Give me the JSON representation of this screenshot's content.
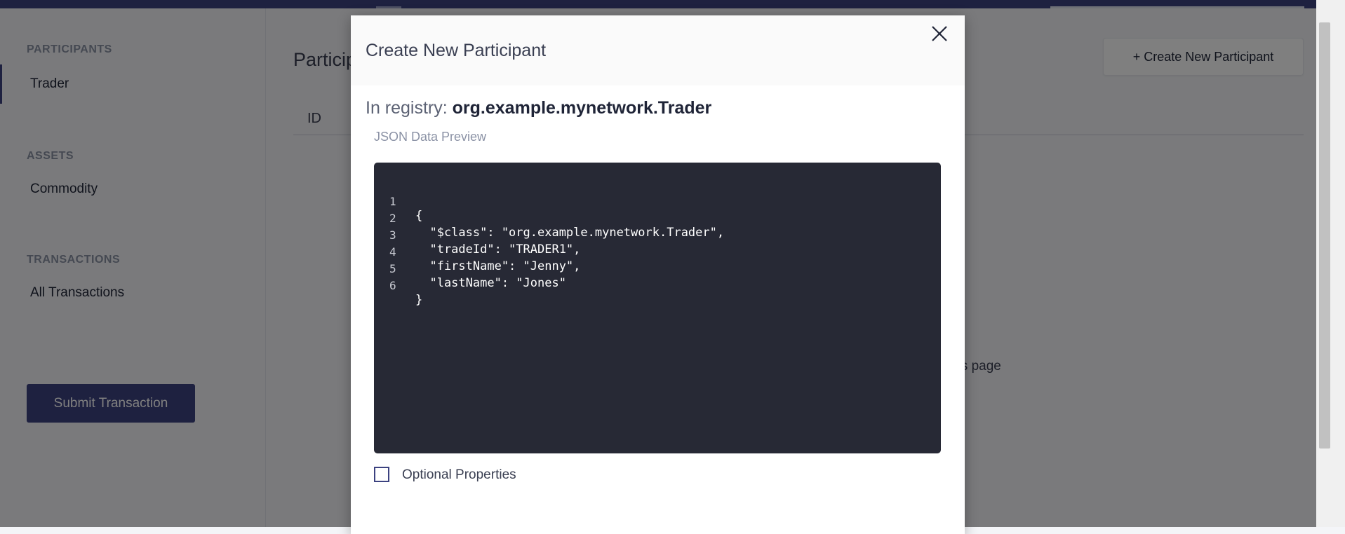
{
  "sidebar": {
    "sections": [
      {
        "title": "PARTICIPANTS",
        "items": [
          {
            "label": "Trader",
            "active": true
          }
        ]
      },
      {
        "title": "ASSETS",
        "items": [
          {
            "label": "Commodity",
            "active": false
          }
        ]
      },
      {
        "title": "TRANSACTIONS",
        "items": [
          {
            "label": "All Transactions",
            "active": false
          }
        ]
      }
    ],
    "submit_label": "Submit Transaction"
  },
  "main": {
    "heading": "Particip",
    "create_button_label": "+ Create New Participant",
    "table_columns": [
      "ID"
    ],
    "empty_text": "his page"
  },
  "modal": {
    "title": "Create New Participant",
    "registry_prefix": "In registry:",
    "registry_name": "org.example.mynetwork.Trader",
    "preview_label": "JSON Data Preview",
    "code_lines": [
      {
        "num": "1",
        "text": "{"
      },
      {
        "num": "2",
        "text": "  \"$class\": \"org.example.mynetwork.Trader\","
      },
      {
        "num": "3",
        "text": "  \"tradeId\": \"TRADER1\","
      },
      {
        "num": "4",
        "text": "  \"firstName\": \"Jenny\","
      },
      {
        "num": "5",
        "text": "  \"lastName\": \"Jones\""
      },
      {
        "num": "6",
        "text": "}"
      }
    ],
    "optional_label": "Optional Properties",
    "optional_checked": false
  },
  "colors": {
    "brand": "#3c4280",
    "code_bg": "#272935",
    "overlay": "rgba(0,0,0,0.5)"
  }
}
